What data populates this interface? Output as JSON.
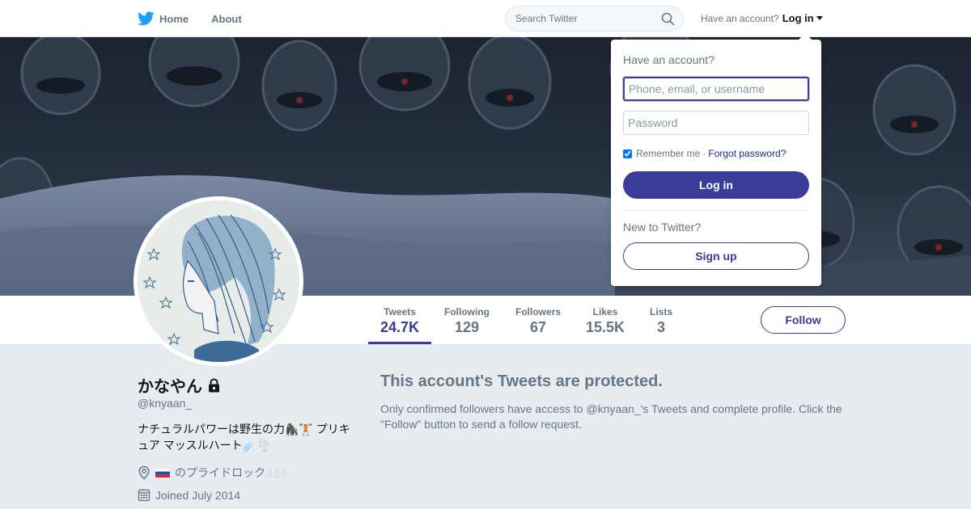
{
  "nav": {
    "home_label": "Home",
    "about_label": "About",
    "search_placeholder": "Search Twitter",
    "have_account_text": "Have an account?",
    "login_label": "Log in"
  },
  "login_dropdown": {
    "heading": "Have an account?",
    "username_placeholder": "Phone, email, or username",
    "password_placeholder": "Password",
    "remember_label": "Remember me",
    "separator": "·",
    "forgot_label": "Forgot password?",
    "login_button": "Log in",
    "new_text": "New to Twitter?",
    "signup_button": "Sign up"
  },
  "stats": [
    {
      "label": "Tweets",
      "value": "24.7K"
    },
    {
      "label": "Following",
      "value": "129"
    },
    {
      "label": "Followers",
      "value": "67"
    },
    {
      "label": "Likes",
      "value": "15.5K"
    },
    {
      "label": "Lists",
      "value": "3"
    }
  ],
  "follow_button": "Follow",
  "profile": {
    "name": "かなやん",
    "handle": "@knyaan_",
    "bio": "ナチュラルパワーは野生の力🦍🏋️ プリキュア マッスルハート☄️🌪️",
    "location": "のプライドロック",
    "joined": "Joined July 2014"
  },
  "protected": {
    "title": "This account's Tweets are protected.",
    "text": "Only confirmed followers have access to @knyaan_'s Tweets and complete profile. Click the \"Follow\" button to send a follow request."
  },
  "colors": {
    "accent": "#3b3b9c",
    "twitter_blue": "#1da1f2",
    "background": "#e6ecf0"
  }
}
